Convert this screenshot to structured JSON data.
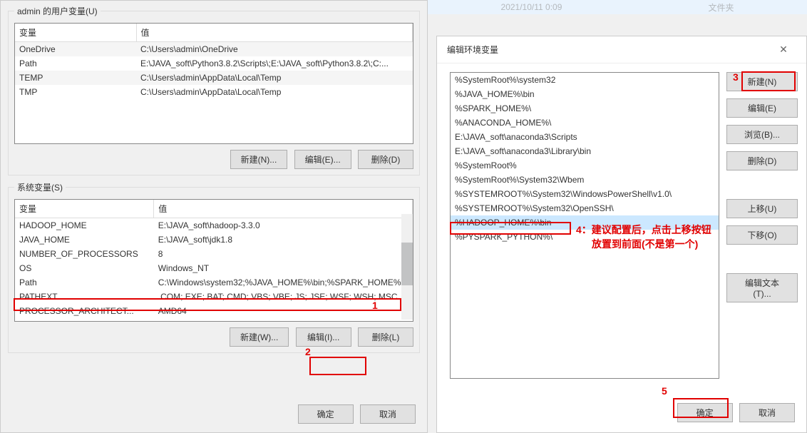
{
  "topStrip": {
    "date": "2021/10/11 0:09",
    "right": "文件夹"
  },
  "userVars": {
    "legend": "admin 的用户变量(U)",
    "headers": {
      "name": "变量",
      "value": "值"
    },
    "rows": [
      {
        "name": "OneDrive",
        "value": "C:\\Users\\admin\\OneDrive"
      },
      {
        "name": "Path",
        "value": "E:\\JAVA_soft\\Python3.8.2\\Scripts\\;E:\\JAVA_soft\\Python3.8.2\\;C:..."
      },
      {
        "name": "TEMP",
        "value": "C:\\Users\\admin\\AppData\\Local\\Temp"
      },
      {
        "name": "TMP",
        "value": "C:\\Users\\admin\\AppData\\Local\\Temp"
      }
    ],
    "buttons": {
      "new": "新建(N)...",
      "edit": "编辑(E)...",
      "del": "删除(D)"
    }
  },
  "sysVars": {
    "legend": "系统变量(S)",
    "headers": {
      "name": "变量",
      "value": "值"
    },
    "rows": [
      {
        "name": "HADOOP_HOME",
        "value": "E:\\JAVA_soft\\hadoop-3.3.0"
      },
      {
        "name": "JAVA_HOME",
        "value": "E:\\JAVA_soft\\jdk1.8"
      },
      {
        "name": "NUMBER_OF_PROCESSORS",
        "value": "8"
      },
      {
        "name": "OS",
        "value": "Windows_NT"
      },
      {
        "name": "Path",
        "value": "C:\\Windows\\system32;%JAVA_HOME%\\bin;%SPARK_HOME%..."
      },
      {
        "name": "PATHEXT",
        "value": ".COM;.EXE;.BAT;.CMD;.VBS;.VBE;.JS;.JSE;.WSF;.WSH;.MSC"
      },
      {
        "name": "PROCESSOR_ARCHITECT...",
        "value": "AMD64"
      }
    ],
    "buttons": {
      "new": "新建(W)...",
      "edit": "编辑(I)...",
      "del": "删除(L)"
    }
  },
  "footer": {
    "ok": "确定",
    "cancel": "取消"
  },
  "editDlg": {
    "title": "编辑环境变量",
    "items": [
      "%SystemRoot%\\system32",
      "%JAVA_HOME%\\bin",
      "%SPARK_HOME%\\",
      "%ANACONDA_HOME%\\",
      "E:\\JAVA_soft\\anaconda3\\Scripts",
      "E:\\JAVA_soft\\anaconda3\\Library\\bin",
      "%SystemRoot%",
      "%SystemRoot%\\System32\\Wbem",
      "%SYSTEMROOT%\\System32\\WindowsPowerShell\\v1.0\\",
      "%SYSTEMROOT%\\System32\\OpenSSH\\",
      "%HADOOP_HOME%\\bin",
      "%PYSPARK_PYTHON%\\"
    ],
    "selectedIndex": 10,
    "buttons": {
      "new": "新建(N)",
      "edit": "编辑(E)",
      "browse": "浏览(B)...",
      "del": "删除(D)",
      "up": "上移(U)",
      "down": "下移(O)",
      "editText": "编辑文本(T)...",
      "ok": "确定",
      "cancel": "取消"
    }
  },
  "annotations": {
    "n1": "1",
    "n2": "2",
    "n3": "3",
    "n4a": "4：建议配置后，点击上移按钮",
    "n4b": "放置到前面(不是第一个)",
    "n5": "5"
  }
}
